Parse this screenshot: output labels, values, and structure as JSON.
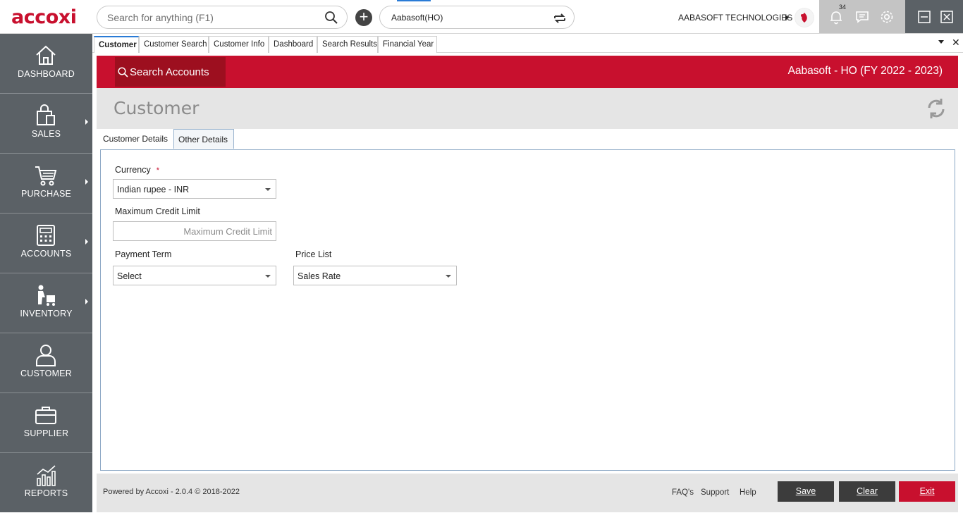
{
  "app": {
    "logo": "accoxi",
    "search_placeholder": "Search for anything (F1)",
    "branch": "Aabasoft(HO)",
    "company": "AABASOFT TECHNOLOGIES",
    "notification_count": "34"
  },
  "sidebar": {
    "items": [
      {
        "label": "DASHBOARD",
        "icon": "home-icon"
      },
      {
        "label": "SALES",
        "icon": "shopping-bag-icon"
      },
      {
        "label": "PURCHASE",
        "icon": "cart-icon"
      },
      {
        "label": "ACCOUNTS",
        "icon": "calculator-icon"
      },
      {
        "label": "INVENTORY",
        "icon": "inventory-icon"
      },
      {
        "label": "CUSTOMER",
        "icon": "user-icon"
      },
      {
        "label": "SUPPLIER",
        "icon": "briefcase-icon"
      },
      {
        "label": "REPORTS",
        "icon": "chart-icon"
      }
    ]
  },
  "tabs": [
    "Customer",
    "Customer Search",
    "Customer Info",
    "Dashboard",
    "Search Results",
    "Financial Year"
  ],
  "header": {
    "search_accounts": "Search Accounts",
    "fy": "Aabasoft - HO (FY 2022 - 2023)",
    "page_title": "Customer"
  },
  "subtabs": [
    "Customer Details",
    "Other Details"
  ],
  "form": {
    "currency_label": "Currency",
    "required_mark": "*",
    "currency_value": "Indian rupee - INR",
    "credit_label": "Maximum Credit Limit",
    "credit_placeholder": "Maximum Credit Limit",
    "payment_label": "Payment Term",
    "payment_value": "Select",
    "price_label": "Price List",
    "price_value": "Sales Rate"
  },
  "footer": {
    "powered": "Powered by Accoxi - 2.0.4 © 2018-2022",
    "faq": "FAQ's",
    "support": "Support",
    "help": "Help",
    "save": "Save",
    "clear": "Clear",
    "exit": "Exit"
  },
  "colors": {
    "brand_red": "#c8102e",
    "sidebar": "#5b6166",
    "dark_button": "#3c3c3c"
  }
}
